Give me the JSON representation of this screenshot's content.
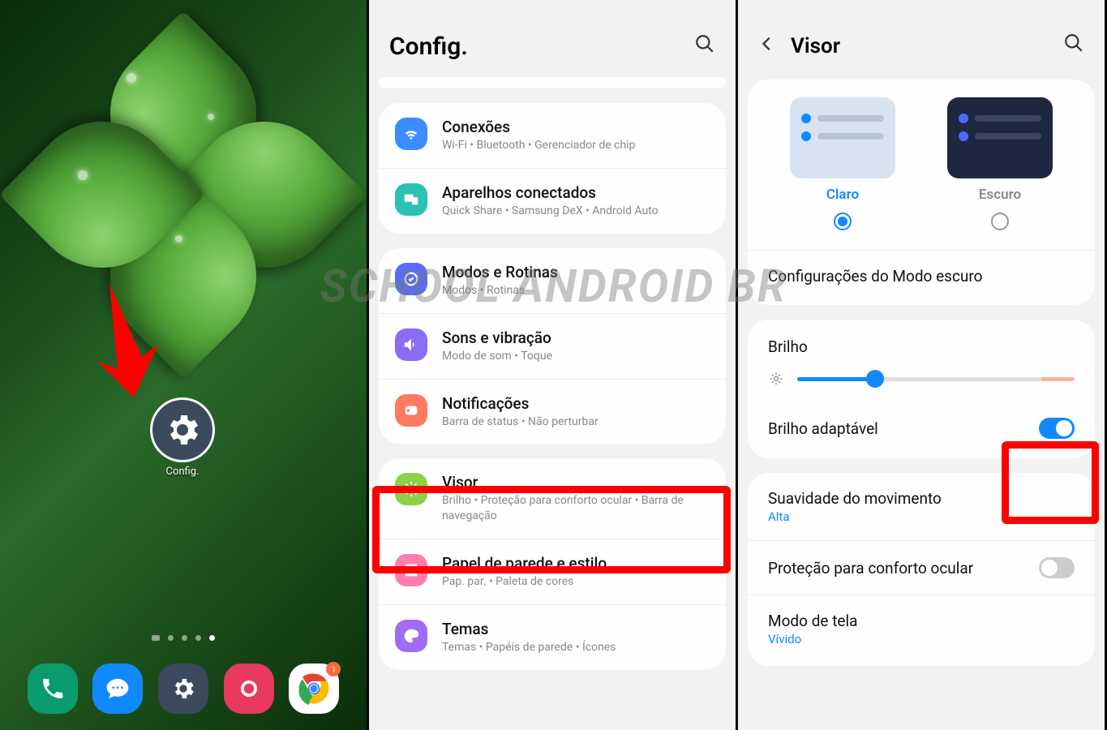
{
  "watermark": "SCHOOL ANDROID BR",
  "panel1": {
    "app_label": "Config.",
    "dock": {
      "chrome_badge": "1"
    }
  },
  "panel2": {
    "title": "Config.",
    "items": [
      {
        "title": "Conexões",
        "sub": "Wi-Fi  •  Bluetooth  •  Gerenciador de chip"
      },
      {
        "title": "Aparelhos conectados",
        "sub": "Quick Share  •  Samsung DeX  •  Android Auto"
      },
      {
        "title": "Modos e Rotinas",
        "sub": "Modos  •  Rotinas"
      },
      {
        "title": "Sons e vibração",
        "sub": "Modo de som  •  Toque"
      },
      {
        "title": "Notificações",
        "sub": "Barra de status  •  Não perturbar"
      },
      {
        "title": "Visor",
        "sub": "Brilho  •  Proteção para conforto ocular  •  Barra de navegação"
      },
      {
        "title": "Papel de parede e estilo",
        "sub": "Pap. par.  •  Paleta de cores"
      },
      {
        "title": "Temas",
        "sub": "Temas  •  Papéis de parede  •  Ícones"
      }
    ]
  },
  "panel3": {
    "title": "Visor",
    "theme_light": "Claro",
    "theme_dark": "Escuro",
    "dark_mode_settings": "Configurações do Modo escuro",
    "brightness": "Brilho",
    "adaptive_brightness": "Brilho adaptável",
    "motion_smoothness": "Suavidade do movimento",
    "motion_value": "Alta",
    "eye_comfort": "Proteção para conforto ocular",
    "screen_mode": "Modo de tela",
    "screen_mode_value": "Vívido"
  }
}
